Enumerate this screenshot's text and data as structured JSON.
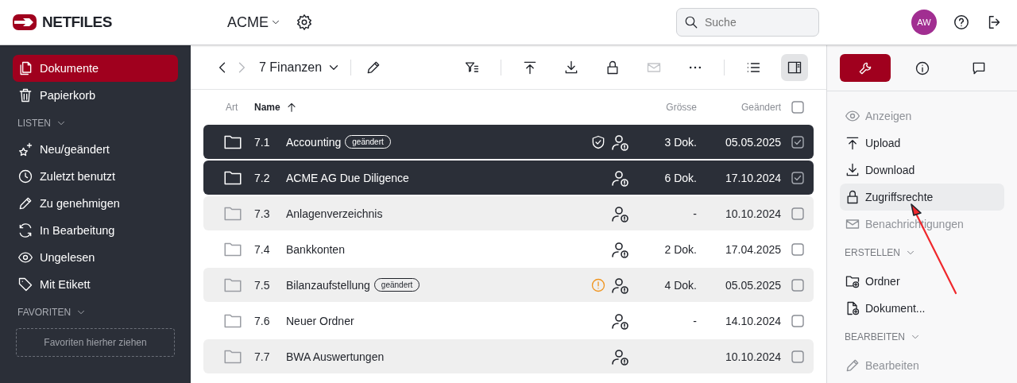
{
  "header": {
    "brand": "NETFILES",
    "workspace": "ACME",
    "search": {
      "placeholder": "Suche"
    },
    "avatar": "AW"
  },
  "sidebar": {
    "items": [
      {
        "kind": "documents",
        "label": "Dokumente",
        "selected": true
      },
      {
        "kind": "trash",
        "label": "Papierkorb",
        "selected": false
      }
    ],
    "sections": [
      {
        "title": "LISTEN",
        "expanded": true,
        "items": [
          {
            "kind": "new",
            "label": "Neu/geändert",
            "selected": false
          },
          {
            "kind": "recent",
            "label": "Zuletzt benutzt",
            "selected": false
          },
          {
            "kind": "approve",
            "label": "Zu genehmigen",
            "selected": false
          },
          {
            "kind": "editing",
            "label": "In Bearbeitung",
            "selected": false
          },
          {
            "kind": "unread",
            "label": "Ungelesen",
            "selected": false
          },
          {
            "kind": "tagged",
            "label": "Mit Etikett",
            "selected": false
          }
        ]
      },
      {
        "title": "FAVORITEN",
        "expanded": true,
        "dropzone": "Favoriten hierher ziehen"
      }
    ]
  },
  "toolbar": {
    "back_disabled": false,
    "forward_disabled": true,
    "folder": "7 Finanzen",
    "groups": [
      [
        {
          "kind": "filter",
          "disabled": false,
          "selected": false
        }
      ],
      [
        {
          "kind": "upload",
          "disabled": false,
          "selected": false
        },
        {
          "kind": "download",
          "disabled": false,
          "selected": false
        },
        {
          "kind": "lock",
          "disabled": false,
          "selected": false
        },
        {
          "kind": "mail",
          "disabled": true,
          "selected": false
        },
        {
          "kind": "more",
          "disabled": false,
          "selected": false
        }
      ],
      [
        {
          "kind": "list",
          "disabled": false,
          "selected": false
        },
        {
          "kind": "panel",
          "disabled": false,
          "selected": true
        }
      ]
    ]
  },
  "table": {
    "columns": {
      "kind": "Art",
      "name": "Name",
      "size": "Grösse",
      "changed": "Geändert"
    },
    "sort_ascending": true,
    "all_checked": false,
    "rows": [
      {
        "number": "7.1",
        "name": "Accounting",
        "badge": "geändert",
        "protected": true,
        "warning": false,
        "size": "3 Dok.",
        "changed": "05.05.2025",
        "selected": true,
        "checked": true
      },
      {
        "number": "7.2",
        "name": "ACME AG Due Diligence",
        "protected": false,
        "warning": false,
        "size": "6 Dok.",
        "changed": "17.10.2024",
        "selected": true,
        "checked": true
      },
      {
        "number": "7.3",
        "name": "Anlagenverzeichnis",
        "protected": false,
        "warning": false,
        "size": "-",
        "changed": "10.10.2024",
        "selected": false,
        "checked": false
      },
      {
        "number": "7.4",
        "name": "Bankkonten",
        "protected": false,
        "warning": false,
        "size": "2 Dok.",
        "changed": "17.04.2025",
        "selected": false,
        "checked": false
      },
      {
        "number": "7.5",
        "name": "Bilanzaufstellung",
        "badge": "geändert",
        "protected": false,
        "warning": true,
        "size": "4 Dok.",
        "changed": "05.05.2025",
        "selected": false,
        "checked": false
      },
      {
        "number": "7.6",
        "name": "Neuer Ordner",
        "protected": false,
        "warning": false,
        "size": "-",
        "changed": "14.10.2024",
        "selected": false,
        "checked": false
      },
      {
        "number": "7.7",
        "name": "BWA Auswertungen",
        "protected": false,
        "warning": false,
        "changed": "10.10.2024",
        "selected": false
      }
    ]
  },
  "panel": {
    "tabs": [
      {
        "kind": "tools",
        "selected": true
      },
      {
        "kind": "info",
        "selected": false
      },
      {
        "kind": "comments",
        "selected": false
      }
    ],
    "groups": [
      {
        "items": [
          {
            "kind": "view",
            "label": "Anzeigen",
            "disabled": true,
            "selected": false
          },
          {
            "kind": "upload",
            "label": "Upload",
            "disabled": false,
            "selected": false
          },
          {
            "kind": "download",
            "label": "Download",
            "disabled": false,
            "selected": false
          },
          {
            "kind": "lock",
            "label": "Zugriffsrechte",
            "disabled": false,
            "selected": true
          },
          {
            "kind": "mail",
            "label": "Benachrichtigungen",
            "disabled": true,
            "selected": false
          }
        ]
      },
      {
        "title": "ERSTELLEN",
        "expanded": true,
        "items": [
          {
            "kind": "new-folder",
            "label": "Ordner",
            "disabled": false,
            "selected": false
          },
          {
            "kind": "new-file",
            "label": "Dokument...",
            "disabled": false,
            "selected": false
          }
        ]
      },
      {
        "title": "BEARBEITEN",
        "expanded": true,
        "items": [
          {
            "kind": "edit",
            "label": "Bearbeiten",
            "disabled": true,
            "selected": false
          }
        ]
      }
    ]
  }
}
